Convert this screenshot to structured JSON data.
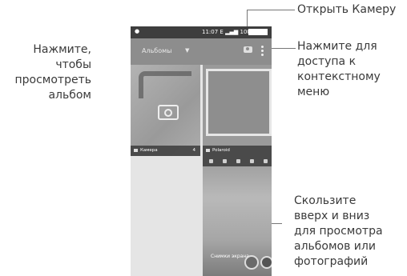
{
  "callouts": {
    "open_camera": "Открыть Камеру",
    "view_album": [
      "Нажмите,",
      "чтобы",
      "просмотреть",
      "альбом"
    ],
    "context_menu": [
      "Нажмите для",
      "доступа к",
      "контекстному",
      "меню"
    ],
    "swipe": [
      "Скользите",
      "вверх и вниз",
      "для просмотра",
      "альбомов или",
      "фотографий"
    ]
  },
  "phone": {
    "status": {
      "time": "11:07",
      "network": "E",
      "battery": "100 %"
    },
    "appbar": {
      "title": "Альбомы"
    },
    "albums": [
      {
        "name": "Камера",
        "count": "4"
      },
      {
        "name": "Polaroid",
        "count": ""
      },
      {
        "name": "Снимки экрана",
        "count": ""
      }
    ]
  }
}
